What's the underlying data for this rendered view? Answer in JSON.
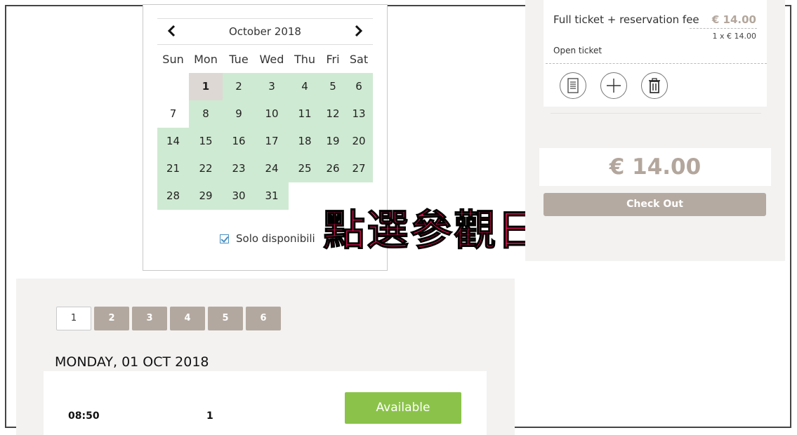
{
  "calendar": {
    "month_title": "October 2018",
    "weekdays": [
      "Sun",
      "Mon",
      "Tue",
      "Wed",
      "Thu",
      "Fri",
      "Sat"
    ],
    "only_available_label": "Solo disponibili",
    "only_available_checked": true,
    "days": [
      {
        "d": "1",
        "col": 1,
        "row": 0,
        "state": "selected"
      },
      {
        "d": "2",
        "col": 2,
        "row": 0,
        "state": "available"
      },
      {
        "d": "3",
        "col": 3,
        "row": 0,
        "state": "available"
      },
      {
        "d": "4",
        "col": 4,
        "row": 0,
        "state": "available"
      },
      {
        "d": "5",
        "col": 5,
        "row": 0,
        "state": "available"
      },
      {
        "d": "6",
        "col": 6,
        "row": 0,
        "state": "available"
      },
      {
        "d": "7",
        "col": 0,
        "row": 1,
        "state": "unavailable"
      },
      {
        "d": "8",
        "col": 1,
        "row": 1,
        "state": "available"
      },
      {
        "d": "9",
        "col": 2,
        "row": 1,
        "state": "available"
      },
      {
        "d": "10",
        "col": 3,
        "row": 1,
        "state": "available"
      },
      {
        "d": "11",
        "col": 4,
        "row": 1,
        "state": "available"
      },
      {
        "d": "12",
        "col": 5,
        "row": 1,
        "state": "available"
      },
      {
        "d": "13",
        "col": 6,
        "row": 1,
        "state": "available"
      },
      {
        "d": "14",
        "col": 0,
        "row": 2,
        "state": "available"
      },
      {
        "d": "15",
        "col": 1,
        "row": 2,
        "state": "available"
      },
      {
        "d": "16",
        "col": 2,
        "row": 2,
        "state": "available"
      },
      {
        "d": "17",
        "col": 3,
        "row": 2,
        "state": "available"
      },
      {
        "d": "18",
        "col": 4,
        "row": 2,
        "state": "available"
      },
      {
        "d": "19",
        "col": 5,
        "row": 2,
        "state": "available"
      },
      {
        "d": "20",
        "col": 6,
        "row": 2,
        "state": "available"
      },
      {
        "d": "21",
        "col": 0,
        "row": 3,
        "state": "available"
      },
      {
        "d": "22",
        "col": 1,
        "row": 3,
        "state": "available"
      },
      {
        "d": "23",
        "col": 2,
        "row": 3,
        "state": "available"
      },
      {
        "d": "24",
        "col": 3,
        "row": 3,
        "state": "available"
      },
      {
        "d": "25",
        "col": 4,
        "row": 3,
        "state": "available"
      },
      {
        "d": "26",
        "col": 5,
        "row": 3,
        "state": "available"
      },
      {
        "d": "27",
        "col": 6,
        "row": 3,
        "state": "available"
      },
      {
        "d": "28",
        "col": 0,
        "row": 4,
        "state": "available"
      },
      {
        "d": "29",
        "col": 1,
        "row": 4,
        "state": "available"
      },
      {
        "d": "30",
        "col": 2,
        "row": 4,
        "state": "available"
      },
      {
        "d": "31",
        "col": 3,
        "row": 4,
        "state": "available"
      }
    ]
  },
  "overlay_text": "點選參觀日期",
  "cart": {
    "ticket_name": "Full ticket + reservation fee",
    "ticket_price": "€ 14.00",
    "ticket_qty": "1 x € 14.00",
    "ticket_type": "Open ticket",
    "total": "€ 14.00",
    "checkout_label": "Check Out"
  },
  "pagination": {
    "pages": [
      "1",
      "2",
      "3",
      "4",
      "5",
      "6"
    ],
    "active_page": "1"
  },
  "schedule": {
    "date_heading": "MONDAY, 01 OCT 2018",
    "slots": [
      {
        "time": "08:50",
        "count": "1",
        "status_label": "Available"
      }
    ]
  },
  "colors": {
    "available_day": "#cfead2",
    "selected_day": "#ddd8d3",
    "price_accent": "#b3a69c",
    "checkout_bg": "#b5aaa1",
    "available_button": "#8bc34a",
    "overlay_text": "#d0114f"
  },
  "icons": {
    "prev_month": "chevron-left-icon",
    "next_month": "chevron-right-icon",
    "cart_actions": [
      "document-icon",
      "plus-icon",
      "trash-icon"
    ]
  }
}
